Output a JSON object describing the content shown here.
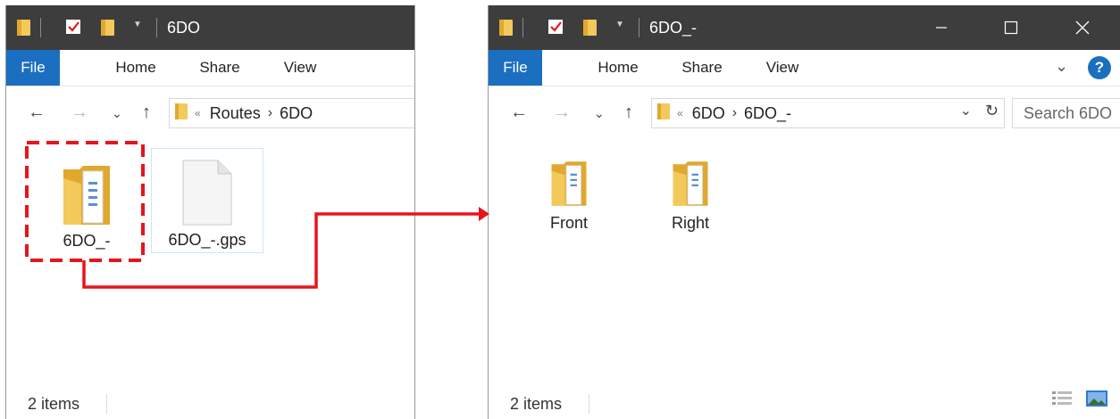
{
  "left_window": {
    "title": "6DO",
    "tabs": [
      "File",
      "Home",
      "Share",
      "View"
    ],
    "breadcrumb": {
      "prefix": "«",
      "parts": [
        "Routes",
        "6DO"
      ]
    },
    "items": [
      {
        "label": "6DO_-",
        "type": "folder",
        "highlighted": true
      },
      {
        "label": "6DO_-.gps",
        "type": "file",
        "selected": true
      }
    ],
    "status": "2 items"
  },
  "right_window": {
    "title": "6DO_-",
    "tabs": [
      "File",
      "Home",
      "Share",
      "View"
    ],
    "breadcrumb": {
      "prefix": "«",
      "parts": [
        "6DO",
        "6DO_-"
      ]
    },
    "search_placeholder": "Search 6DO",
    "items": [
      {
        "label": "Front",
        "type": "folder"
      },
      {
        "label": "Right",
        "type": "folder"
      }
    ],
    "status": "2 items",
    "help_label": "?"
  },
  "colors": {
    "titlebar": "#3d3d3d",
    "file_tab": "#1a6fc1",
    "annotation_red": "#e8141b",
    "folder_yellow": "#f3c95b",
    "folder_dark": "#e0a82e"
  }
}
